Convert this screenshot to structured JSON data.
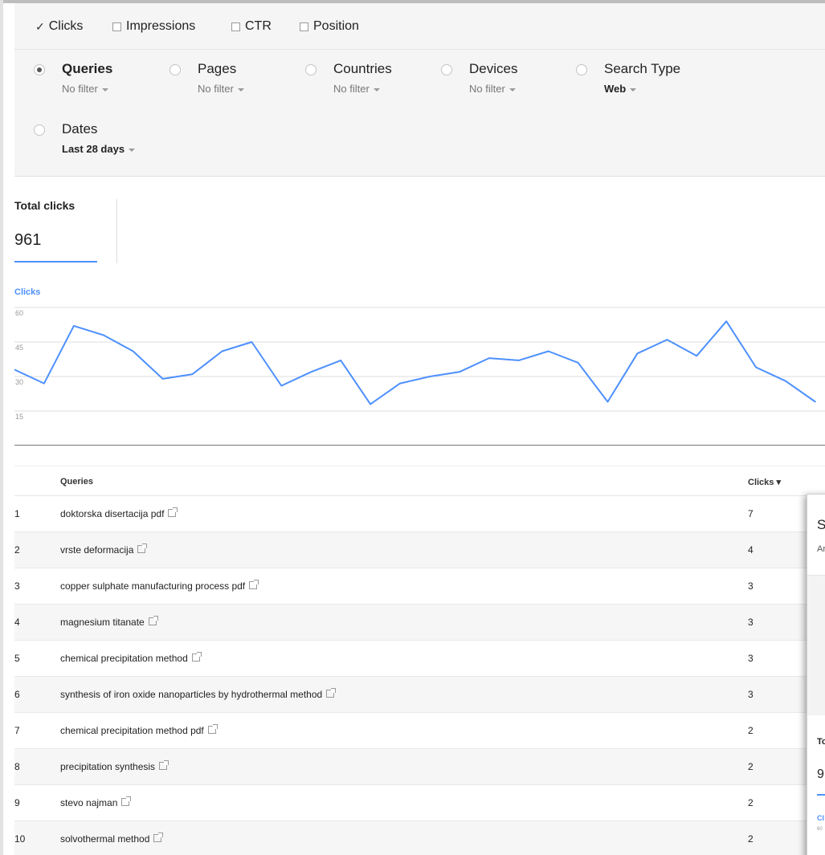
{
  "metrics": [
    {
      "label": "Clicks",
      "checked": true
    },
    {
      "label": "Impressions",
      "checked": false
    },
    {
      "label": "CTR",
      "checked": false
    },
    {
      "label": "Position",
      "checked": false
    }
  ],
  "dimensions": [
    {
      "label": "Queries",
      "sub": "No filter",
      "selected": true
    },
    {
      "label": "Pages",
      "sub": "No filter",
      "selected": false
    },
    {
      "label": "Countries",
      "sub": "No filter",
      "selected": false
    },
    {
      "label": "Devices",
      "sub": "No filter",
      "selected": false
    },
    {
      "label": "Search Type",
      "sub": "Web",
      "selected": false
    },
    {
      "label": "Dates",
      "sub": "Last 28 days",
      "selected": false
    }
  ],
  "total": {
    "label": "Total clicks",
    "value": "961"
  },
  "chart_data": {
    "type": "line",
    "title": "Clicks",
    "xlabel": "",
    "ylabel": "",
    "ylim": [
      0,
      60
    ],
    "yticks": [
      60,
      45,
      30,
      15
    ],
    "grid": true,
    "series": [
      {
        "name": "Clicks",
        "color": "#4d90fe",
        "values": [
          33,
          27,
          52,
          48,
          41,
          29,
          31,
          41,
          45,
          26,
          32,
          37,
          18,
          27,
          30,
          32,
          38,
          37,
          41,
          36,
          19,
          40,
          46,
          39,
          54,
          34,
          28,
          19
        ]
      }
    ]
  },
  "table": {
    "col_query": "Queries",
    "col_clicks": "Clicks ▾",
    "rows": [
      {
        "n": "1",
        "q": "doktorska disertacija pdf",
        "c": "7"
      },
      {
        "n": "2",
        "q": "vrste deformacija",
        "c": "4"
      },
      {
        "n": "3",
        "q": "copper sulphate manufacturing process pdf",
        "c": "3"
      },
      {
        "n": "4",
        "q": "magnesium titanate",
        "c": "3"
      },
      {
        "n": "5",
        "q": "chemical precipitation method",
        "c": "3"
      },
      {
        "n": "6",
        "q": "synthesis of iron oxide nanoparticles by hydrothermal method",
        "c": "3"
      },
      {
        "n": "7",
        "q": "chemical precipitation method pdf",
        "c": "2"
      },
      {
        "n": "8",
        "q": "precipitation synthesis",
        "c": "2"
      },
      {
        "n": "9",
        "q": "stevo najman",
        "c": "2"
      },
      {
        "n": "10",
        "q": "solvothermal method",
        "c": "2"
      }
    ]
  },
  "overlay": {
    "s": "S",
    "an": "Ar",
    "to": "To",
    "nine": "9",
    "cl": "Cl",
    "sixty": "60"
  }
}
